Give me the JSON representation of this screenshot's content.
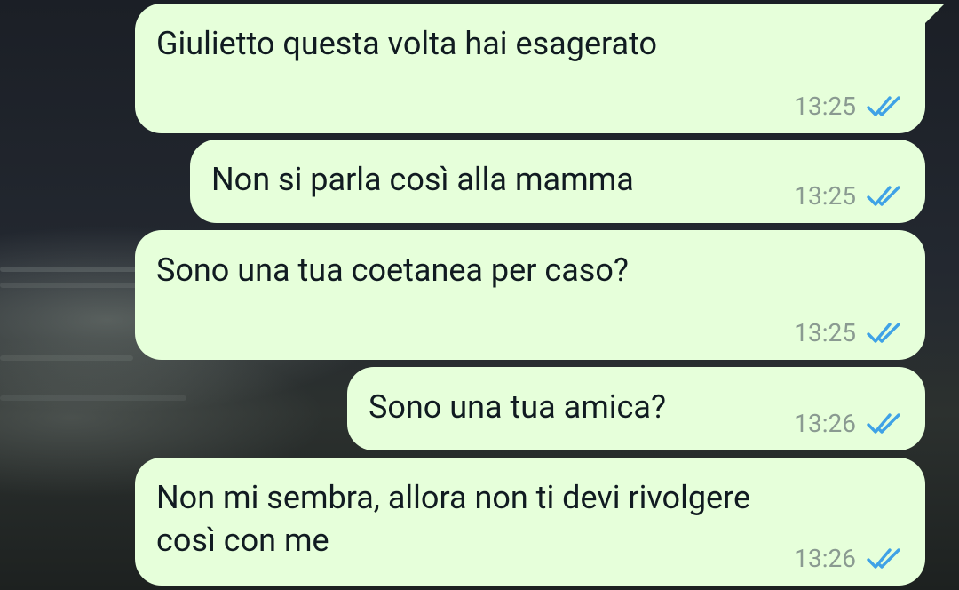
{
  "colors": {
    "bubble_bg": "#e6ffda",
    "text": "#111b21",
    "time": "#8a9a91",
    "read_ticks": "#3fa2e6"
  },
  "messages": [
    {
      "text": "Giulietto questa volta hai esagerato",
      "time": "13:25",
      "status_icon": "double-check-read-icon"
    },
    {
      "text": "Non si parla così alla mamma",
      "time": "13:25",
      "status_icon": "double-check-read-icon"
    },
    {
      "text": "Sono una tua coetanea per caso?",
      "time": "13:25",
      "status_icon": "double-check-read-icon"
    },
    {
      "text": "Sono una tua amica?",
      "time": "13:26",
      "status_icon": "double-check-read-icon"
    },
    {
      "text": "Non mi sembra, allora non ti devi rivolgere\ncosì con me",
      "time": "13:26",
      "status_icon": "double-check-read-icon"
    }
  ]
}
